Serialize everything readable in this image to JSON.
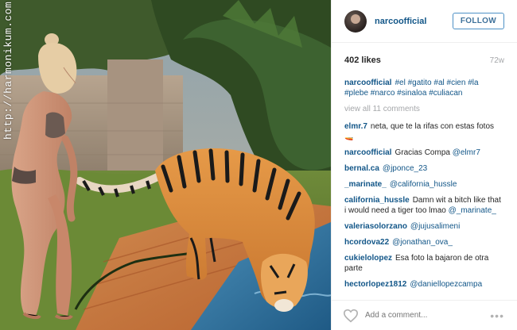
{
  "watermark": "http://harmonikum.com",
  "post": {
    "username": "narcoofficial",
    "follow_label": "FOLLOW",
    "likes": "402 likes",
    "age": "72w",
    "caption_user": "narcoofficial",
    "caption_tags": "#el #gatito #al #cien #la #plebe #narco #sinaloa #culiacan",
    "view_all": "view all 11 comments",
    "add_comment_placeholder": "Add a comment...",
    "more_label": "•••"
  },
  "comments": [
    {
      "user": "elmr.7",
      "text": "neta, que te la rifas con estas fotos"
    },
    {
      "user": "narcoofficial",
      "text": "Gracias Compa",
      "mention": "@elmr7"
    },
    {
      "user": "bernal.ca",
      "text": "",
      "mention": "@jponce_23"
    },
    {
      "user": "_marinate_",
      "text": "",
      "mention": "@california_hussle"
    },
    {
      "user": "california_hussle",
      "text": "Damn wit a bitch like that i would need a tiger too lmao",
      "mention": "@_marinate_"
    },
    {
      "user": "valeriasolorzano",
      "text": "",
      "mention": "@jujusalimeni"
    },
    {
      "user": "hcordova22",
      "text": "",
      "mention": "@jonathan_ova_"
    },
    {
      "user": "cukielolopez",
      "text": "Esa foto la bajaron de otra parte"
    },
    {
      "user": "hectorlopez1812",
      "text": "",
      "mention": "@daniellopezcampa"
    }
  ]
}
